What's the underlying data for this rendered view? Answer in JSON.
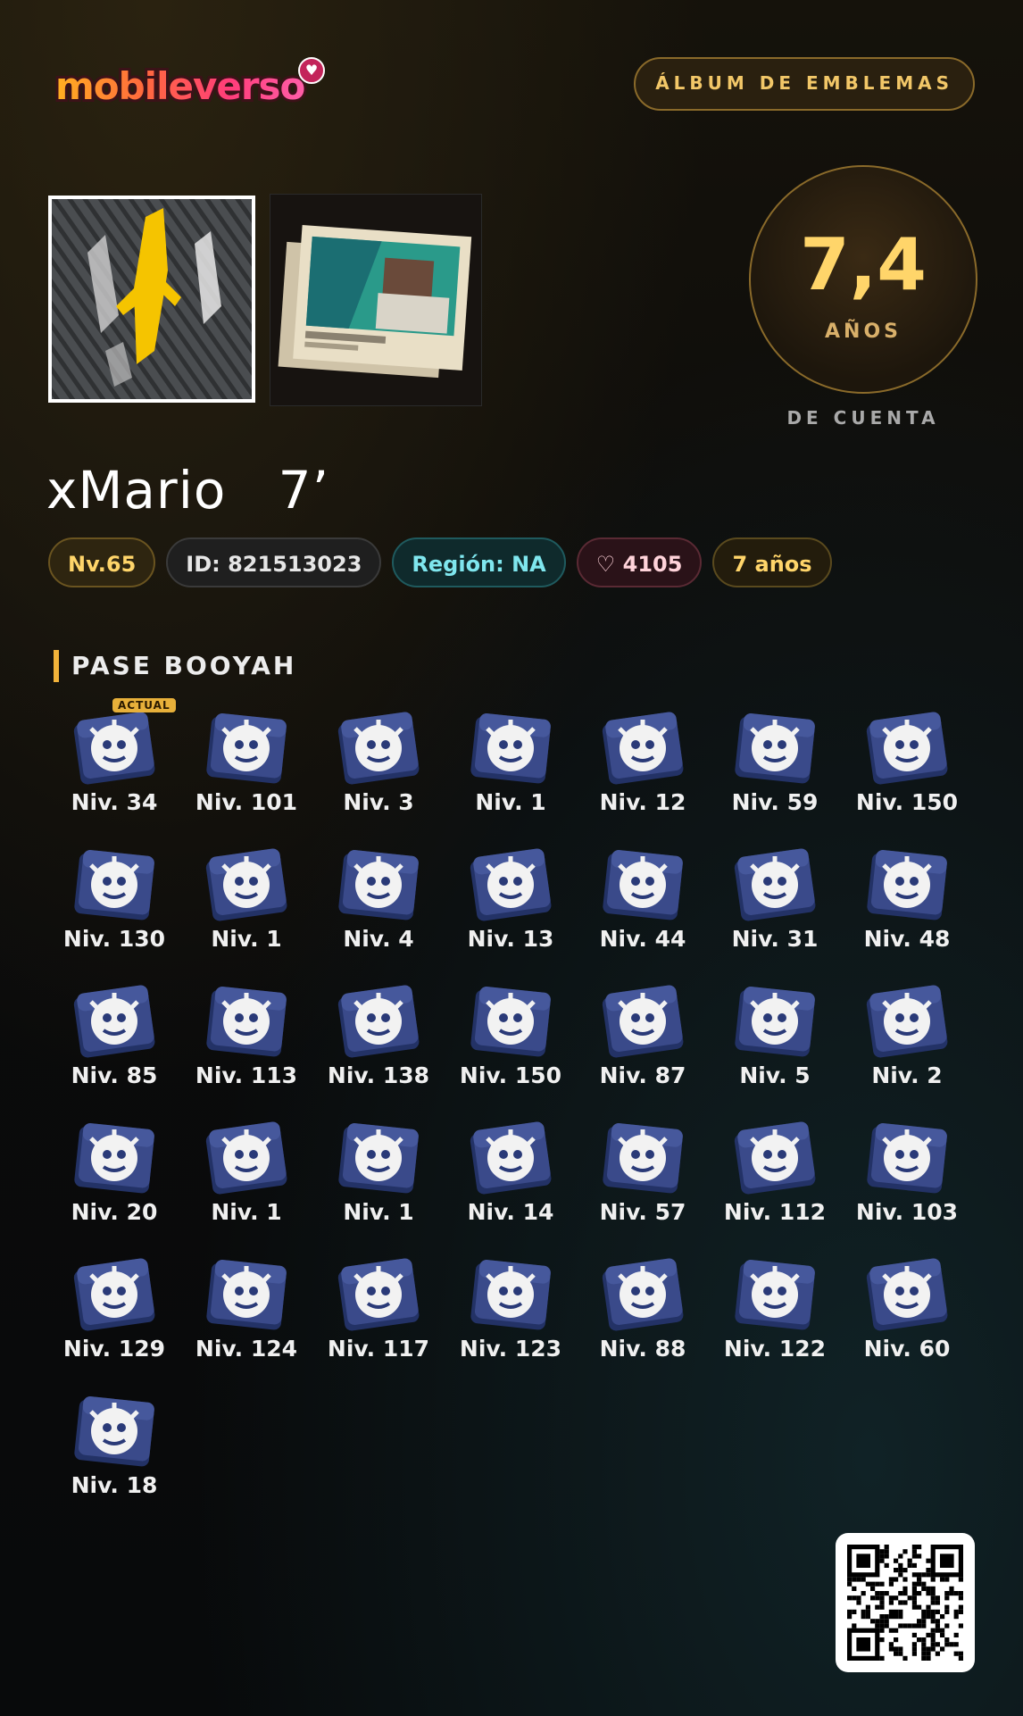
{
  "header": {
    "logo_text": "mobileverso",
    "album_button_label": "ÁLBUM DE EMBLEMAS"
  },
  "account_age": {
    "value": "7,4",
    "unit": "AÑOS",
    "caption": "DE CUENTA"
  },
  "player": {
    "name": "xMario   7’",
    "badges": {
      "level": "Nv.65",
      "id": "ID: 821513023",
      "region": "Región: NA",
      "likes": "4105",
      "years": "7 años"
    }
  },
  "booyah_pass": {
    "title": "PASE BOOYAH",
    "current_tag": "ACTUAL",
    "items": [
      {
        "label": "Niv. 34",
        "icon": "apple-emblem-icon",
        "current": true
      },
      {
        "label": "Niv. 101",
        "icon": "wolf-emblem-icon"
      },
      {
        "label": "Niv. 3",
        "icon": "swirl-emblem-icon"
      },
      {
        "label": "Niv. 1",
        "icon": "fox-emblem-icon"
      },
      {
        "label": "Niv. 12",
        "icon": "crossbow-emblem-icon"
      },
      {
        "label": "Niv. 59",
        "icon": "ghost-emblem-icon"
      },
      {
        "label": "Niv. 150",
        "icon": "z-symbol-emblem-icon"
      },
      {
        "label": "Niv. 130",
        "icon": "skull-crown-emblem-icon"
      },
      {
        "label": "Niv. 1",
        "icon": "crossed-arrows-emblem-icon"
      },
      {
        "label": "Niv. 4",
        "icon": "clown-emblem-icon"
      },
      {
        "label": "Niv. 13",
        "icon": "hooded-face-emblem-icon"
      },
      {
        "label": "Niv. 44",
        "icon": "box-face-emblem-icon"
      },
      {
        "label": "Niv. 31",
        "icon": "comic-emblem-icon"
      },
      {
        "label": "Niv. 48",
        "icon": "dragon-emblem-icon"
      },
      {
        "label": "Niv. 85",
        "icon": "xx-shield-emblem-icon"
      },
      {
        "label": "Niv. 113",
        "icon": "ox-face-emblem-icon"
      },
      {
        "label": "Niv. 138",
        "icon": "spider-emblem-icon"
      },
      {
        "label": "Niv. 150",
        "icon": "leo-sign-emblem-icon"
      },
      {
        "label": "Niv. 87",
        "icon": "fighter-emblem-icon"
      },
      {
        "label": "Niv. 5",
        "icon": "leaves-emblem-icon"
      },
      {
        "label": "Niv. 2",
        "icon": "wolf-head-emblem-icon"
      },
      {
        "label": "Niv. 20",
        "icon": "star-crest-emblem-icon"
      },
      {
        "label": "Niv. 1",
        "icon": "demon-face-emblem-icon"
      },
      {
        "label": "Niv. 1",
        "icon": "spiky-skull-emblem-icon"
      },
      {
        "label": "Niv. 14",
        "icon": "planet-emblem-icon"
      },
      {
        "label": "Niv. 57",
        "icon": "warrior-emblem-icon"
      },
      {
        "label": "Niv. 112",
        "icon": "spiky-ball-emblem-icon"
      },
      {
        "label": "Niv. 103",
        "icon": "shark-emblem-icon"
      },
      {
        "label": "Niv. 129",
        "icon": "atom-emblem-icon"
      },
      {
        "label": "Niv. 124",
        "icon": "crowned-skull-emblem-icon"
      },
      {
        "label": "Niv. 117",
        "icon": "witch-emblem-icon"
      },
      {
        "label": "Niv. 123",
        "icon": "mammoth-emblem-icon"
      },
      {
        "label": "Niv. 88",
        "icon": "bird-emblem-icon"
      },
      {
        "label": "Niv. 122",
        "icon": "beast-skull-emblem-icon"
      },
      {
        "label": "Niv. 60",
        "icon": "raptor-emblem-icon"
      },
      {
        "label": "Niv. 18",
        "icon": "pumpkin-emblem-icon"
      }
    ]
  },
  "colors": {
    "gold": "#ffd56a",
    "accent_bar": "#f2b33a",
    "emblem_blue": "#3a4a8a",
    "region_cyan": "#7fe6ee"
  }
}
